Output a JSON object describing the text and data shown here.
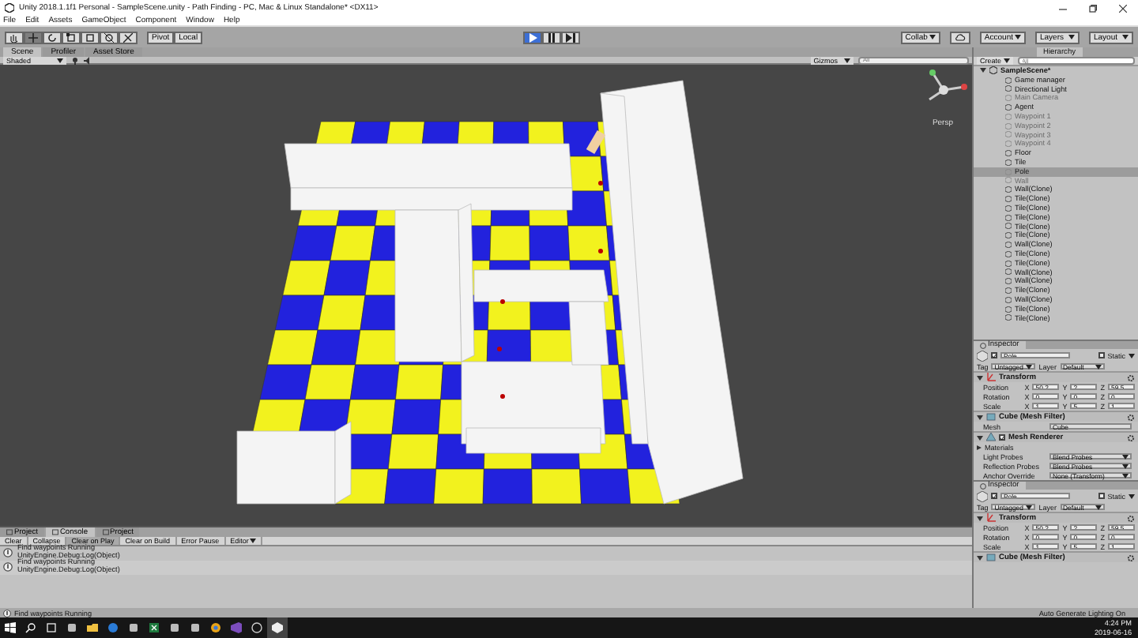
{
  "window": {
    "title": "Unity 2018.1.1f1 Personal - SampleScene.unity - Path Finding - PC, Mac & Linux Standalone* <DX11>"
  },
  "menu": [
    "File",
    "Edit",
    "Assets",
    "GameObject",
    "Component",
    "Window",
    "Help"
  ],
  "toolbar": {
    "tools": [
      {
        "kind": "hand",
        "selected": false
      },
      {
        "kind": "move",
        "selected": true
      },
      {
        "kind": "rotate",
        "selected": false
      },
      {
        "kind": "scale",
        "selected": false
      },
      {
        "kind": "rect",
        "selected": false
      },
      {
        "kind": "transform",
        "selected": false
      },
      {
        "kind": "custom",
        "selected": false
      }
    ],
    "pivot": "Pivot",
    "space": "Local",
    "playback": [
      {
        "kind": "play",
        "selected": true
      },
      {
        "kind": "pause",
        "selected": false
      },
      {
        "kind": "step",
        "selected": false
      }
    ],
    "collab": "Collab",
    "account": "Account",
    "layers": "Layers",
    "layout": "Layout"
  },
  "scene": {
    "tabs": [
      {
        "label": "Scene",
        "selected": true
      },
      {
        "label": "Profiler",
        "selected": false
      },
      {
        "label": "Asset Store",
        "selected": false
      }
    ],
    "shading": "Shaded",
    "gizmos": "Gizmos",
    "search_placeholder": "All",
    "view_label": "Persp"
  },
  "hierarchy": {
    "tab": "Hierarchy",
    "create": "Create",
    "search_placeholder": "All",
    "scene": "SampleScene*",
    "items": [
      {
        "label": "Game manager",
        "selected": false,
        "disabled": false
      },
      {
        "label": "Directional Light",
        "selected": false,
        "disabled": false
      },
      {
        "label": "Main Camera",
        "selected": false,
        "disabled": true
      },
      {
        "label": "Agent",
        "selected": false,
        "disabled": false
      },
      {
        "label": "Waypoint 1",
        "selected": false,
        "disabled": true
      },
      {
        "label": "Waypoint 2",
        "selected": false,
        "disabled": true
      },
      {
        "label": "Waypoint 3",
        "selected": false,
        "disabled": true
      },
      {
        "label": "Waypoint 4",
        "selected": false,
        "disabled": true
      },
      {
        "label": "Floor",
        "selected": false,
        "disabled": false
      },
      {
        "label": "Tile",
        "selected": false,
        "disabled": false
      },
      {
        "label": "Pole",
        "selected": true,
        "disabled": true
      },
      {
        "label": "Wall",
        "selected": false,
        "disabled": true
      },
      {
        "label": "Wall(Clone)",
        "selected": false,
        "disabled": false
      },
      {
        "label": "Tile(Clone)",
        "selected": false,
        "disabled": false
      },
      {
        "label": "Tile(Clone)",
        "selected": false,
        "disabled": false
      },
      {
        "label": "Tile(Clone)",
        "selected": false,
        "disabled": false
      },
      {
        "label": "Tile(Clone)",
        "selected": false,
        "disabled": false
      },
      {
        "label": "Tile(Clone)",
        "selected": false,
        "disabled": false
      },
      {
        "label": "Wall(Clone)",
        "selected": false,
        "disabled": false
      },
      {
        "label": "Tile(Clone)",
        "selected": false,
        "disabled": false
      },
      {
        "label": "Tile(Clone)",
        "selected": false,
        "disabled": false
      },
      {
        "label": "Wall(Clone)",
        "selected": false,
        "disabled": false
      },
      {
        "label": "Wall(Clone)",
        "selected": false,
        "disabled": false
      },
      {
        "label": "Tile(Clone)",
        "selected": false,
        "disabled": false
      },
      {
        "label": "Wall(Clone)",
        "selected": false,
        "disabled": false
      },
      {
        "label": "Tile(Clone)",
        "selected": false,
        "disabled": false
      },
      {
        "label": "Tile(Clone)",
        "selected": false,
        "disabled": false
      }
    ]
  },
  "inspectors": [
    {
      "tab": "Inspector",
      "name": "Pole",
      "active": true,
      "static": "Static",
      "static_checked": false,
      "tag_label": "Tag",
      "tag": "Untagged",
      "layer_label": "Layer",
      "layer": "Default",
      "components": [
        {
          "kind": "transform",
          "title": "Transform",
          "rows": [
            {
              "label": "Position",
              "values": [
                {
                  "axis": "X",
                  "value": "50.2"
                },
                {
                  "axis": "Y",
                  "value": "2"
                },
                {
                  "axis": "Z",
                  "value": "59.5"
                }
              ]
            },
            {
              "label": "Rotation",
              "values": [
                {
                  "axis": "X",
                  "value": "0"
                },
                {
                  "axis": "Y",
                  "value": "0"
                },
                {
                  "axis": "Z",
                  "value": "0"
                }
              ]
            },
            {
              "label": "Scale",
              "values": [
                {
                  "axis": "X",
                  "value": "1"
                },
                {
                  "axis": "Y",
                  "value": "5"
                },
                {
                  "axis": "Z",
                  "value": "1"
                }
              ]
            }
          ]
        },
        {
          "kind": "mesh_filter",
          "title": "Cube (Mesh Filter)",
          "fields": [
            {
              "label": "Mesh",
              "value": "Cube"
            }
          ]
        },
        {
          "kind": "mesh_renderer",
          "title": "Mesh Renderer",
          "enabled": true,
          "section": "Materials",
          "fields": [
            {
              "label": "Light Probes",
              "value": "Blend Probes"
            },
            {
              "label": "Reflection Probes",
              "value": "Blend Probes"
            },
            {
              "label": "Anchor Override",
              "value": "None (Transform)"
            }
          ]
        }
      ]
    },
    {
      "tab": "Inspector",
      "name": "Pole",
      "active": true,
      "static": "Static",
      "static_checked": false,
      "tag_label": "Tag",
      "tag": "Untagged",
      "layer_label": "Layer",
      "layer": "Default",
      "components": [
        {
          "kind": "transform",
          "title": "Transform",
          "rows": [
            {
              "label": "Position",
              "values": [
                {
                  "axis": "X",
                  "value": "50.2"
                },
                {
                  "axis": "Y",
                  "value": "2"
                },
                {
                  "axis": "Z",
                  "value": "59.5"
                }
              ]
            },
            {
              "label": "Rotation",
              "values": [
                {
                  "axis": "X",
                  "value": "0"
                },
                {
                  "axis": "Y",
                  "value": "0"
                },
                {
                  "axis": "Z",
                  "value": "0"
                }
              ]
            },
            {
              "label": "Scale",
              "values": [
                {
                  "axis": "X",
                  "value": "1"
                },
                {
                  "axis": "Y",
                  "value": "5"
                },
                {
                  "axis": "Z",
                  "value": "1"
                }
              ]
            }
          ]
        },
        {
          "kind": "mesh_filter",
          "title": "Cube (Mesh Filter)"
        }
      ]
    }
  ],
  "console": {
    "tabs": [
      {
        "label": "Project",
        "selected": false
      },
      {
        "label": "Console",
        "selected": true
      },
      {
        "label": "Project",
        "selected": false
      }
    ],
    "buttons": [
      {
        "label": "Clear",
        "on": false
      },
      {
        "label": "Collapse",
        "on": false
      },
      {
        "label": "Clear on Play",
        "on": true
      },
      {
        "label": "Clear on Build",
        "on": false
      },
      {
        "label": "Error Pause",
        "on": false
      },
      {
        "label": "Editor",
        "on": false
      }
    ],
    "entries": [
      {
        "message": "Find waypoints Running",
        "detail": "UnityEngine.Debug:Log(Object)"
      },
      {
        "message": "Find waypoints Running",
        "detail": "UnityEngine.Debug:Log(Object)"
      }
    ]
  },
  "status": {
    "message": "Find waypoints Running",
    "lighting": "Auto Generate Lighting On"
  },
  "taskbar": {
    "apps": [
      {
        "kind": "start",
        "selected": false
      },
      {
        "kind": "search",
        "selected": false
      },
      {
        "kind": "taskview",
        "selected": false
      },
      {
        "kind": "app",
        "selected": false
      },
      {
        "kind": "folder",
        "selected": false
      },
      {
        "kind": "browser",
        "selected": false
      },
      {
        "kind": "app",
        "selected": false
      },
      {
        "kind": "sheet",
        "selected": false
      },
      {
        "kind": "app",
        "selected": false
      },
      {
        "kind": "app",
        "selected": false
      },
      {
        "kind": "globe",
        "selected": false
      },
      {
        "kind": "ide",
        "selected": false
      },
      {
        "kind": "circle",
        "selected": false
      },
      {
        "kind": "unity",
        "selected": true
      }
    ],
    "time": "4:24 PM",
    "date": "2019-06-16"
  }
}
